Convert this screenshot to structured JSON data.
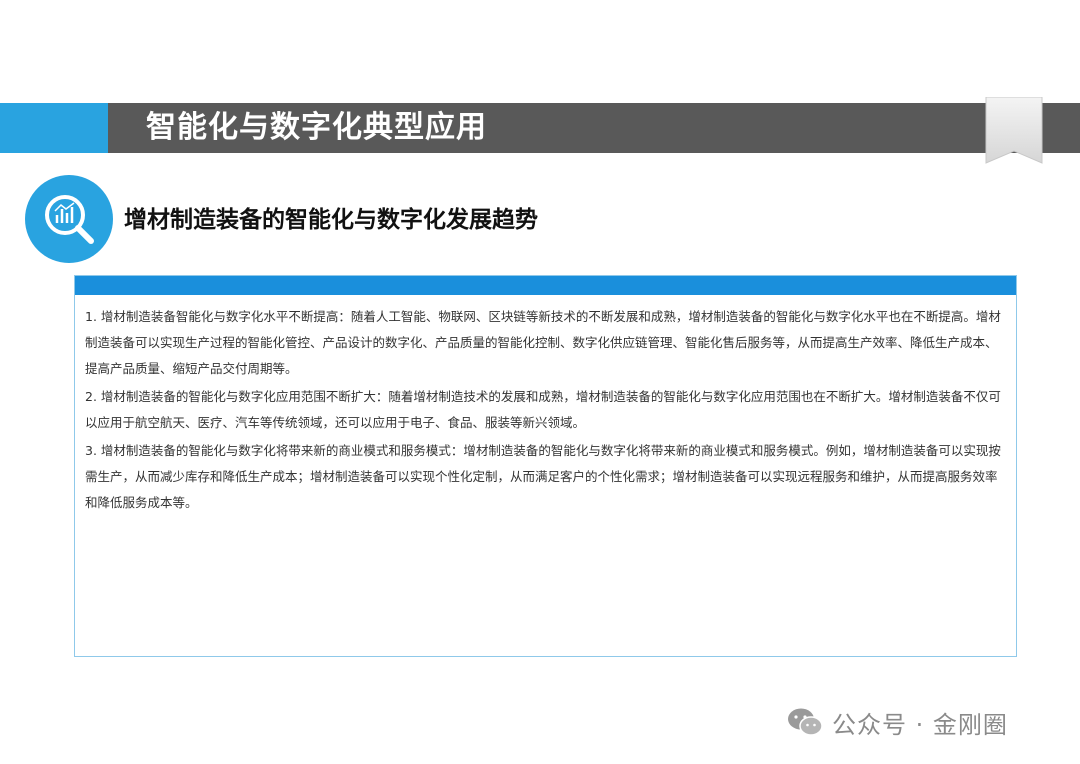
{
  "header": {
    "title": "智能化与数字化典型应用"
  },
  "section": {
    "icon": "search-analytics-icon",
    "subtitle": "增材制造装备的智能化与数字化发展趋势"
  },
  "content": {
    "paragraphs": [
      "1. 增材制造装备智能化与数字化水平不断提高：随着人工智能、物联网、区块链等新技术的不断发展和成熟，增材制造装备的智能化与数字化水平也在不断提高。增材制造装备可以实现生产过程的智能化管控、产品设计的数字化、产品质量的智能化控制、数字化供应链管理、智能化售后服务等，从而提高生产效率、降低生产成本、提高产品质量、缩短产品交付周期等。",
      "2. 增材制造装备的智能化与数字化应用范围不断扩大：随着增材制造技术的发展和成熟，增材制造装备的智能化与数字化应用范围也在不断扩大。增材制造装备不仅可以应用于航空航天、医疗、汽车等传统领域，还可以应用于电子、食品、服装等新兴领域。",
      "3. 增材制造装备的智能化与数字化将带来新的商业模式和服务模式：增材制造装备的智能化与数字化将带来新的商业模式和服务模式。例如，增材制造装备可以实现按需生产，从而减少库存和降低生产成本；增材制造装备可以实现个性化定制，从而满足客户的个性化需求；增材制造装备可以实现远程服务和维护，从而提高服务效率和降低服务成本等。"
    ]
  },
  "watermark": {
    "icon": "wechat-icon",
    "text": "公众号 · 金刚圈"
  },
  "colors": {
    "accent_blue": "#29a3e0",
    "title_bar_gray": "#595959",
    "box_header_blue": "#1a8fdc"
  }
}
